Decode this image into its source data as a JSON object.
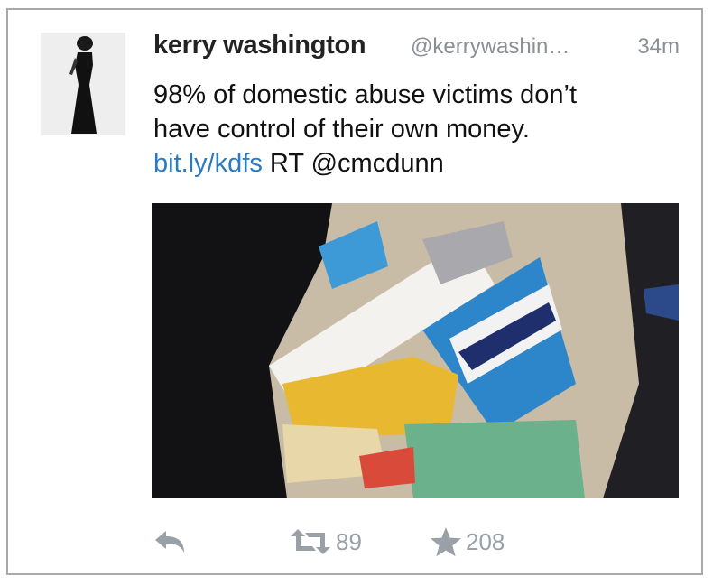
{
  "tweet": {
    "author_name": "kerry washington",
    "handle": "@kerrywashin…",
    "time": "34m",
    "text_line1": "98% of domestic abuse victims don’t",
    "text_line2": "have control of their own money.",
    "link_text": "bit.ly/kdfs",
    "text_tail": " RT @cmcdunn"
  },
  "actions": {
    "reply_icon": "reply-icon",
    "retweet_icon": "retweet-icon",
    "retweet_count": "89",
    "favorite_icon": "star-icon",
    "favorite_count": "208"
  },
  "colors": {
    "link": "#2a7bc0",
    "muted": "#8a8f96",
    "action": "#9aa0a7",
    "border": "#a9a9a9"
  }
}
